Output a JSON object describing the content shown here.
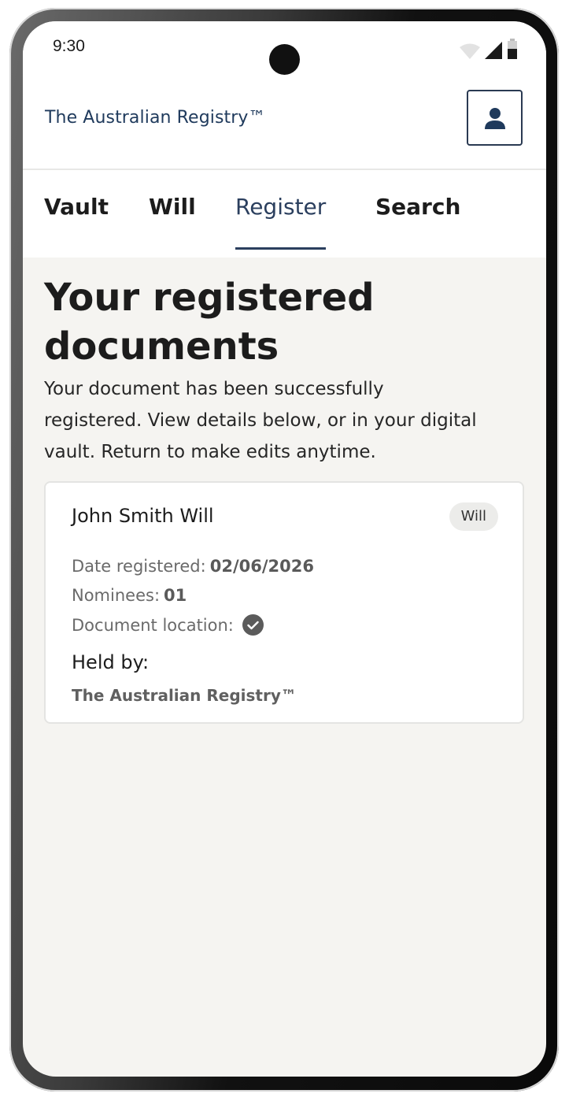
{
  "status_bar": {
    "time": "9:30",
    "icons": [
      "wifi-icon",
      "cell-signal-icon",
      "battery-icon"
    ]
  },
  "header": {
    "brand": "The Australian Registry™",
    "profile_icon": "user-icon"
  },
  "nav": {
    "tabs": [
      {
        "label": "Vault",
        "active": false
      },
      {
        "label": "Will",
        "active": false
      },
      {
        "label": "Register",
        "active": true
      },
      {
        "label": "Search",
        "active": false
      }
    ]
  },
  "main": {
    "title": "Your registered documents",
    "description": "Your document has been successfully registered. View details below, or in your digital vault. Return to make edits anytime."
  },
  "document_card": {
    "title": "John Smith Will",
    "badge": "Will",
    "date_label": "Date registered:",
    "date_value": "02/06/2026",
    "nominees_label": "Nominees:",
    "nominees_value": "01",
    "location_label": "Document location:",
    "location_icon": "check-circle-icon",
    "held_by_label": "Held by:",
    "held_by_value": "The Australian Registry™"
  },
  "colors": {
    "brand": "#1f3a5c",
    "active_tab": "#2b3f5e",
    "background": "#f5f4f1"
  }
}
